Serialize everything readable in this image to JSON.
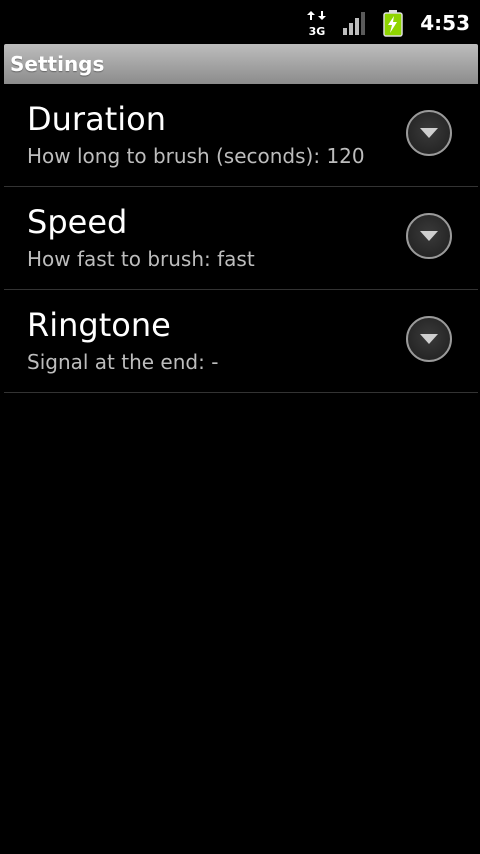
{
  "status_bar": {
    "network_label": "3G",
    "time": "4:53",
    "icons": [
      "network-3g-icon",
      "signal-strength-icon",
      "battery-charging-icon"
    ]
  },
  "title_bar": {
    "title": "Settings"
  },
  "preferences": [
    {
      "title": "Duration",
      "summary": "How long to brush (seconds): 120",
      "icon": "chevron-down-icon"
    },
    {
      "title": "Speed",
      "summary": "How fast to brush: fast",
      "icon": "chevron-down-icon"
    },
    {
      "title": "Ringtone",
      "summary": "Signal at the end: -",
      "icon": "chevron-down-icon"
    }
  ],
  "colors": {
    "background": "#000000",
    "title_bar_top": "#bdbdbd",
    "title_bar_bottom": "#8c8c8c",
    "summary_text": "#bdbdbd",
    "divider": "#333333",
    "battery_green": "#8fd400"
  }
}
